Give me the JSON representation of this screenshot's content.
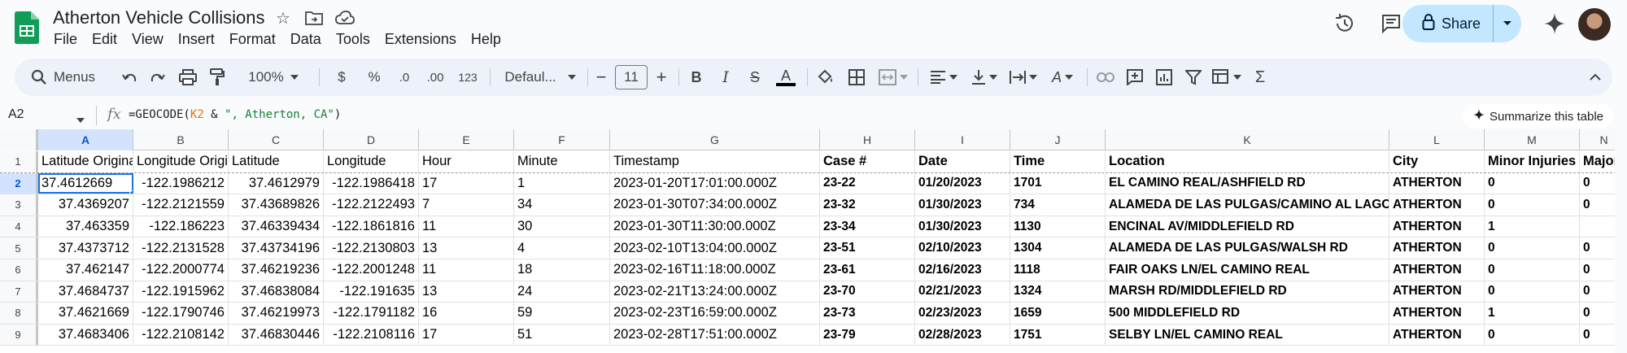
{
  "doc": {
    "title": "Atherton Vehicle Collisions"
  },
  "menu": [
    "File",
    "Edit",
    "View",
    "Insert",
    "Format",
    "Data",
    "Tools",
    "Extensions",
    "Help"
  ],
  "share": {
    "label": "Share"
  },
  "toolbar": {
    "search_label": "Menus",
    "zoom": "100%",
    "currency": "$",
    "percent": "%",
    "dec_decrease": ".0",
    "dec_increase": ".00",
    "number_format": "123",
    "font": "Defaul...",
    "font_size": "11"
  },
  "formula_bar": {
    "cell_ref": "A2",
    "fx": "fx",
    "formula_prefix": "=GEOCODE(",
    "formula_ref": "K2",
    "formula_mid": " & ",
    "formula_str": "\", Atherton, CA\"",
    "formula_suffix": ")",
    "summarize_label": "Summarize this table"
  },
  "sheet": {
    "columns": [
      "A",
      "B",
      "C",
      "D",
      "E",
      "F",
      "G",
      "H",
      "I",
      "J",
      "K",
      "L",
      "M",
      "N"
    ],
    "header_row": [
      "Latitude Original",
      "Longitude Original",
      "Latitude",
      "Longitude",
      "Hour",
      "Minute",
      "Timestamp",
      "Case #",
      "Date",
      "Time",
      "Location",
      "City",
      "Minor Injuries",
      "Major Injuries"
    ],
    "rows": [
      [
        "37.4612669",
        "-122.1986212",
        "37.4612979",
        "-122.1986418",
        "17",
        "1",
        "2023-01-20T17:01:00.000Z",
        "23-22",
        "01/20/2023",
        "1701",
        "EL CAMINO REAL/ASHFIELD RD",
        "ATHERTON",
        "0",
        "0"
      ],
      [
        "37.4369207",
        "-122.2121559",
        "37.43689826",
        "-122.2122493",
        "7",
        "34",
        "2023-01-30T07:34:00.000Z",
        "23-32",
        "01/30/2023",
        "734",
        "ALAMEDA DE LAS PULGAS/CAMINO AL LAGO",
        "ATHERTON",
        "0",
        "0"
      ],
      [
        "37.463359",
        "-122.186223",
        "37.46339434",
        "-122.1861816",
        "11",
        "30",
        "2023-01-30T11:30:00.000Z",
        "23-34",
        "01/30/2023",
        "1130",
        "ENCINAL AV/MIDDLEFIELD RD",
        "ATHERTON",
        "1",
        ""
      ],
      [
        "37.4373712",
        "-122.2131528",
        "37.43734196",
        "-122.2130803",
        "13",
        "4",
        "2023-02-10T13:04:00.000Z",
        "23-51",
        "02/10/2023",
        "1304",
        "ALAMEDA DE LAS PULGAS/WALSH RD",
        "ATHERTON",
        "0",
        "0"
      ],
      [
        "37.462147",
        "-122.2000774",
        "37.46219236",
        "-122.2001248",
        "11",
        "18",
        "2023-02-16T11:18:00.000Z",
        "23-61",
        "02/16/2023",
        "1118",
        "FAIR OAKS LN/EL CAMINO REAL",
        "ATHERTON",
        "0",
        "0"
      ],
      [
        "37.4684737",
        "-122.1915962",
        "37.46838084",
        "-122.191635",
        "13",
        "24",
        "2023-02-21T13:24:00.000Z",
        "23-70",
        "02/21/2023",
        "1324",
        "MARSH RD/MIDDLEFIELD RD",
        "ATHERTON",
        "0",
        "0"
      ],
      [
        "37.4621669",
        "-122.1790746",
        "37.46219973",
        "-122.1791182",
        "16",
        "59",
        "2023-02-23T16:59:00.000Z",
        "23-73",
        "02/23/2023",
        "1659",
        "500 MIDDLEFIELD RD",
        "ATHERTON",
        "1",
        "0"
      ],
      [
        "37.4683406",
        "-122.2108142",
        "37.46830446",
        "-122.2108116",
        "17",
        "51",
        "2023-02-28T17:51:00.000Z",
        "23-79",
        "02/28/2023",
        "1751",
        "SELBY LN/EL CAMINO REAL",
        "ATHERTON",
        "0",
        "0"
      ]
    ]
  },
  "colors": {
    "accent": "#0b57d0",
    "share_bg": "#c2e7ff",
    "sheets_green": "#0f9d58"
  }
}
